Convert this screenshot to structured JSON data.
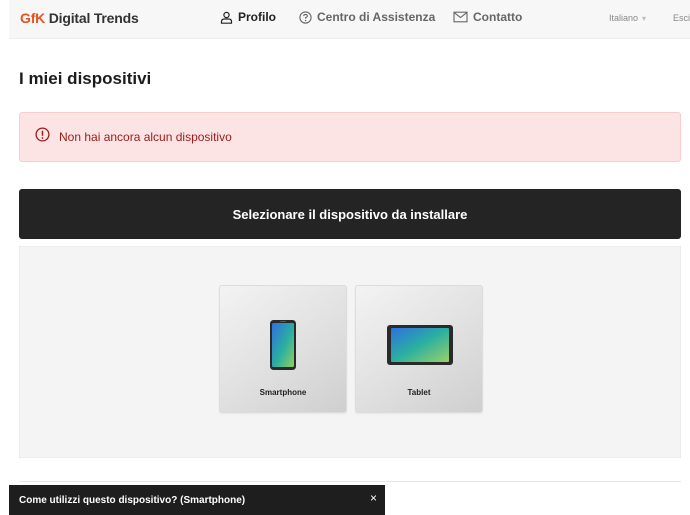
{
  "header": {
    "brand_prefix": "GfK",
    "brand_suffix": " Digital Trends",
    "nav": {
      "profile": "Profilo",
      "help": "Centro di Assistenza",
      "contact": "Contatto"
    },
    "language": "Italiano",
    "logout": "Esci"
  },
  "main": {
    "title": "I miei dispositivi",
    "alert": "Non hai ancora alcun dispositivo",
    "select_header": "Selezionare il dispositivo da installare",
    "devices": [
      {
        "label": "Smartphone",
        "icon": "smartphone-icon"
      },
      {
        "label": "Tablet",
        "icon": "tablet-icon"
      }
    ]
  },
  "toast": {
    "text": "Come utilizzi questo dispositivo? (Smartphone)",
    "close": "×"
  },
  "colors": {
    "brand": "#e8541e",
    "alert_bg": "#fde4e4",
    "alert_text": "#9a1b1b",
    "dark_bar": "#242424"
  }
}
